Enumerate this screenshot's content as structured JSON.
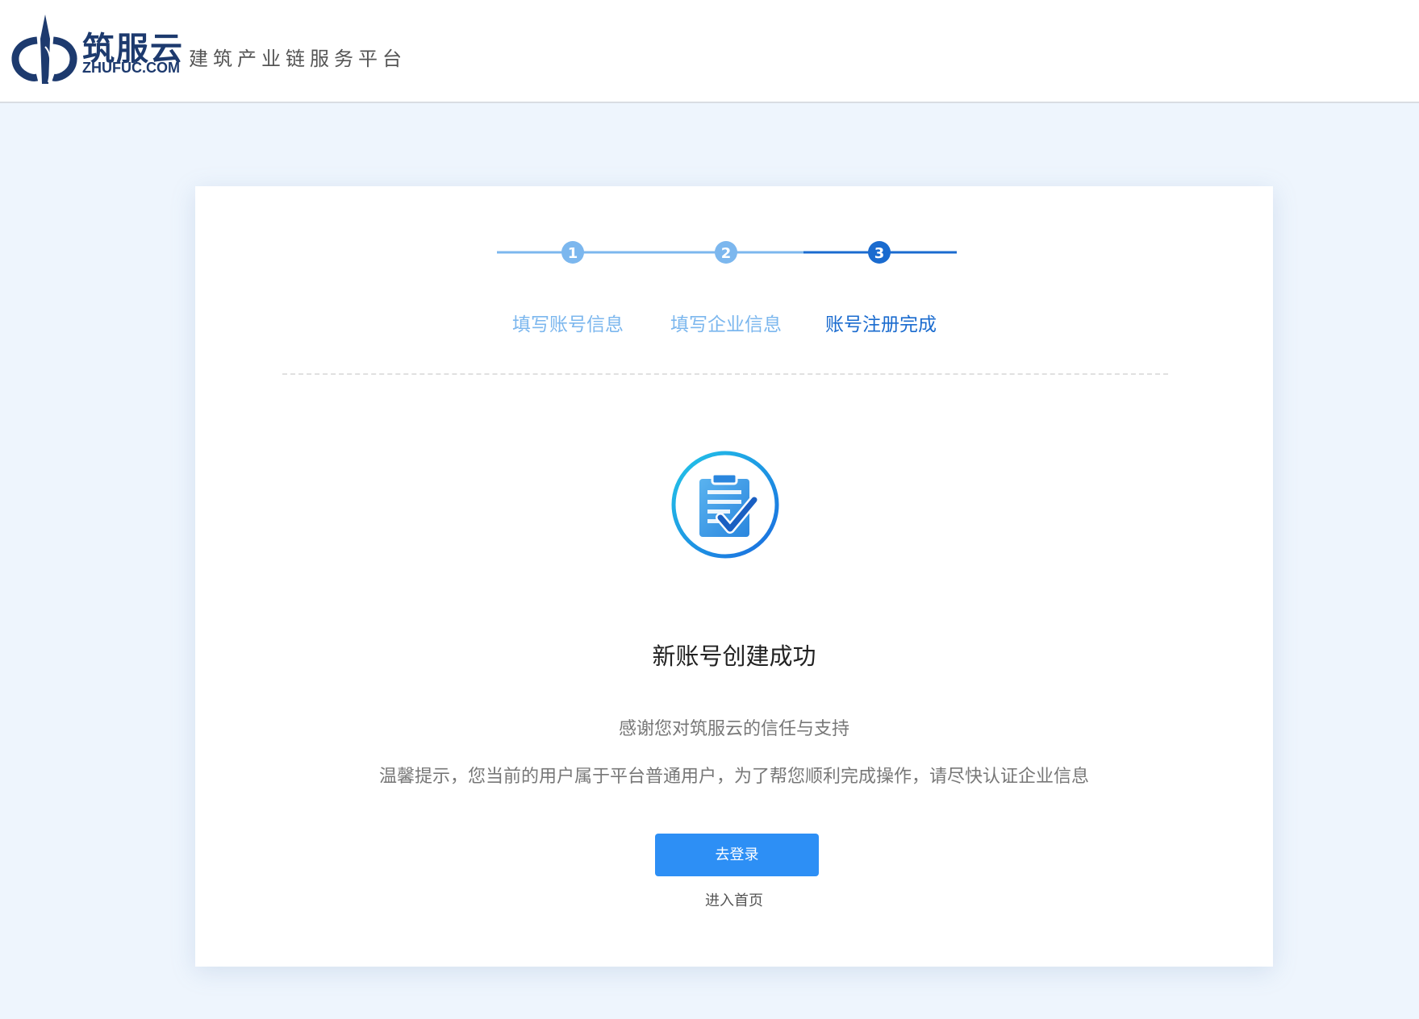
{
  "header": {
    "brand_name": "筑服云",
    "brand_domain": "ZHUFUC.COM",
    "slogan": "建筑产业链服务平台",
    "logo_icon": "zhufuyun-logo-icon"
  },
  "steps": [
    {
      "number": "1",
      "label": "填写账号信息",
      "state": "done"
    },
    {
      "number": "2",
      "label": "填写企业信息",
      "state": "done"
    },
    {
      "number": "3",
      "label": "账号注册完成",
      "state": "active"
    }
  ],
  "result": {
    "icon": "clipboard-check-icon",
    "title": "新账号创建成功",
    "thanks": "感谢您对筑服云的信任与支持",
    "tip": "温馨提示，您当前的用户属于平台普通用户，为了帮您顺利完成操作，请尽快认证企业信息"
  },
  "actions": {
    "login_label": "去登录",
    "home_label": "进入首页"
  },
  "colors": {
    "page_bg": "#eef5fd",
    "step_done": "#7cb7ee",
    "step_active": "#1a6bcf",
    "primary_button": "#2d8ff5",
    "brand": "#1d3a6e"
  }
}
